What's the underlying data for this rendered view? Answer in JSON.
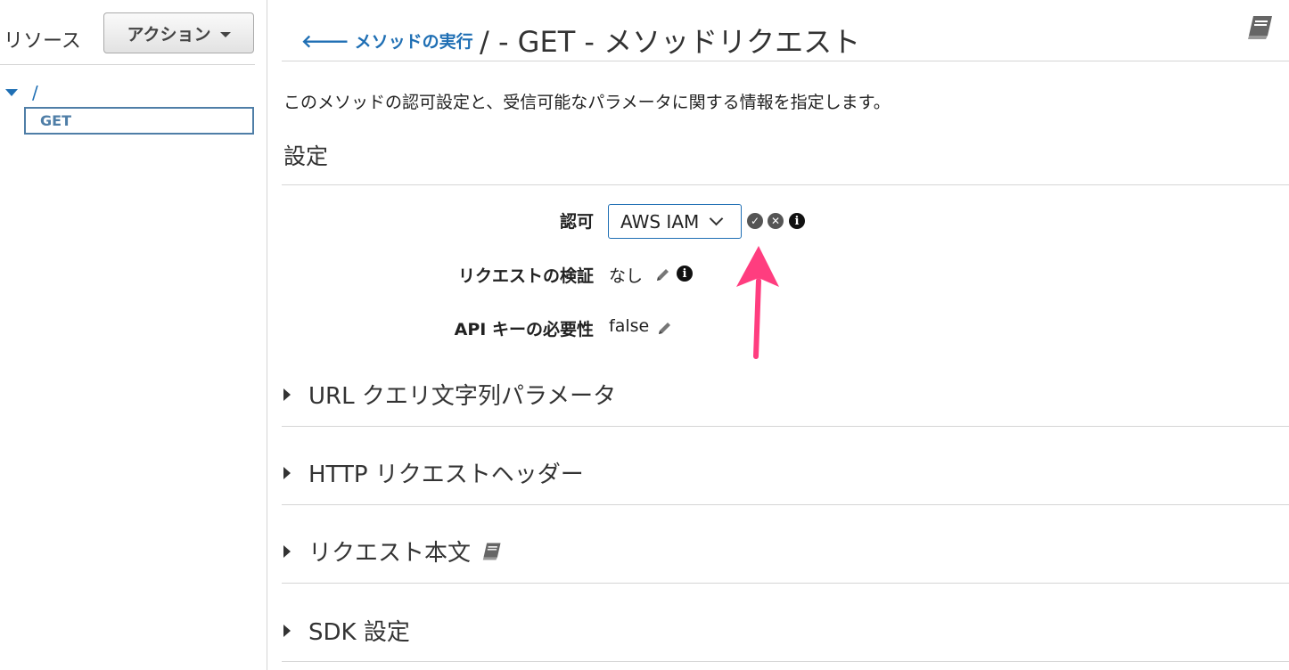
{
  "sidebar": {
    "title": "リソース",
    "actions_label": "アクション",
    "tree_root": "/",
    "tree_selected": "GET"
  },
  "header": {
    "back_link": "メソッドの実行",
    "title": "/ - GET - メソッドリクエスト"
  },
  "main": {
    "description": "このメソッドの認可設定と、受信可能なパラメータに関する情報を指定します。",
    "settings_heading": "設定",
    "fields": {
      "auth_label": "認可",
      "auth_value": "AWS IAM",
      "validation_label": "リクエストの検証",
      "validation_value": "なし",
      "apikey_label": "API キーの必要性",
      "apikey_value": "false"
    },
    "sections": [
      {
        "label": "URL クエリ文字列パラメータ"
      },
      {
        "label": "HTTP リクエストヘッダー"
      },
      {
        "label": "リクエスト本文"
      },
      {
        "label": "SDK 設定"
      }
    ]
  },
  "colors": {
    "link": "#1f6fb4",
    "annotation_arrow": "#ff3d7f",
    "border": "#d5d5d5"
  }
}
